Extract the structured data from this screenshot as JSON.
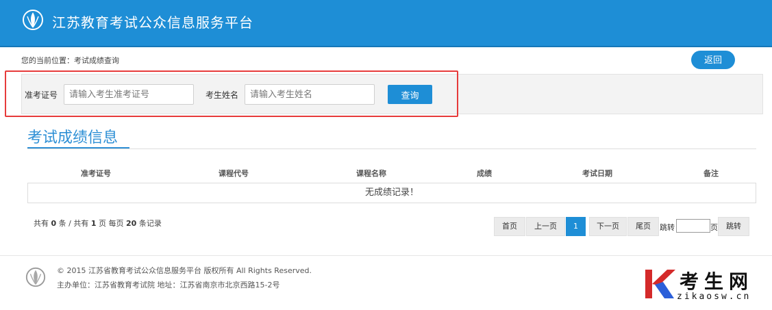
{
  "header": {
    "site_title": "江苏教育考试公众信息服务平台"
  },
  "breadcrumb": "您的当前位置：考试成绩查询",
  "back_button": "返回",
  "search": {
    "ticket_label": "准考证号",
    "ticket_placeholder": "请输入考生准考证号",
    "name_label": "考生姓名",
    "name_placeholder": "请输入考生姓名",
    "submit_label": "查询"
  },
  "results": {
    "title": "考试成绩信息",
    "columns": [
      "准考证号",
      "课程代号",
      "课程名称",
      "成绩",
      "考试日期",
      "备注"
    ],
    "empty_message": "无成绩记录！"
  },
  "pager": {
    "info_prefix": "共有",
    "total_records": "0",
    "info_mid1": "条 / 共有",
    "total_pages": "1",
    "info_mid2": "页 每页",
    "page_size": "20",
    "info_suffix": "条记录",
    "first": "首页",
    "prev": "上一页",
    "current": "1",
    "next": "下一页",
    "last": "尾页",
    "jump_prefix": "跳转",
    "jump_suffix": "页",
    "jump_button": "跳转"
  },
  "footer": {
    "copyright": "© 2015 江苏省教育考试公众信息服务平台 版权所有 All Rights Reserved.",
    "organizer": "主办单位：江苏省教育考试院 地址：江苏省南京市北京西路15-2号"
  },
  "watermark": {
    "brand_cn": "考生网",
    "brand_en": "zikaosw.cn"
  },
  "colors": {
    "primary": "#1e8ed6",
    "highlight": "#e63a3a",
    "title": "#2d8fd5"
  }
}
